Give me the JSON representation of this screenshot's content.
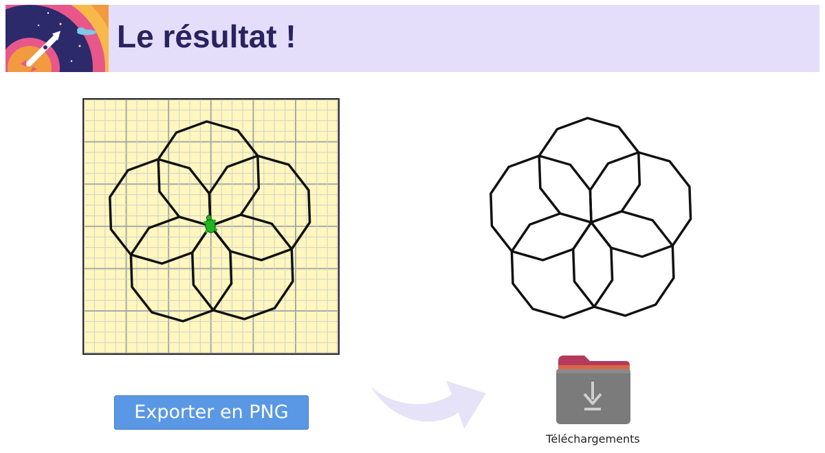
{
  "header": {
    "title": "Le résultat !",
    "background_color": "#e4defa",
    "title_color": "#2a2360"
  },
  "logo": {
    "icon": "rocket-space-icon"
  },
  "canvas": {
    "grid_background": "#fff7bd",
    "grid_major_color": "#a9a9a9",
    "grid_minor_color": "#cfcfcf",
    "stroke_color": "#111111",
    "turtle_color": "#1fb51f",
    "pattern": {
      "petals": 5,
      "sides": 10
    }
  },
  "export_button": {
    "label": "Exporter en PNG",
    "color": "#5a98e6"
  },
  "downloads_folder": {
    "label": "Téléchargements",
    "icon": "download-folder-icon"
  },
  "arrow": {
    "icon": "curved-arrow-icon",
    "color": "#e6e2f8"
  }
}
